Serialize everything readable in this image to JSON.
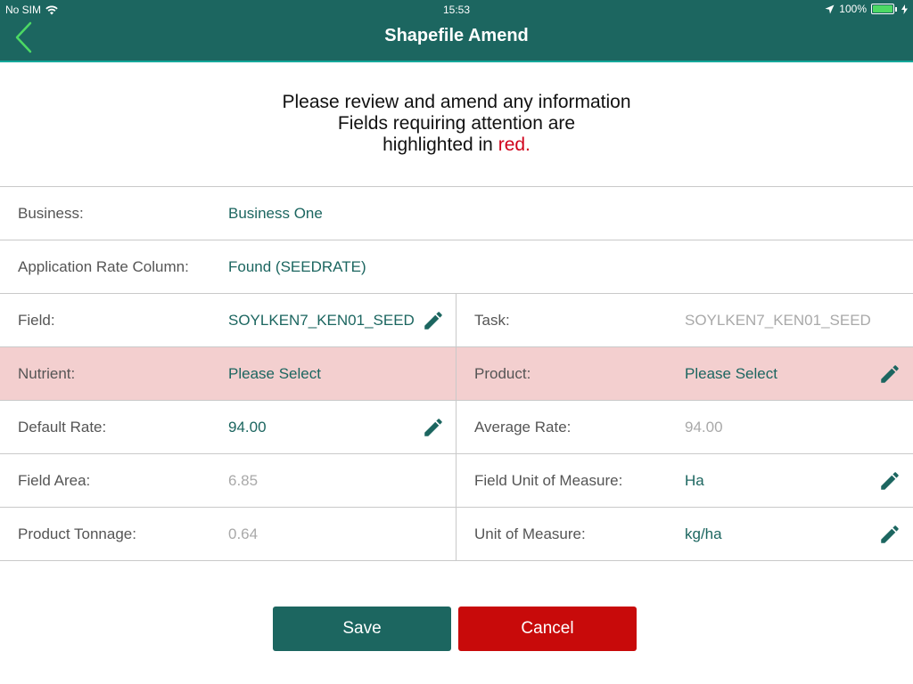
{
  "status_bar": {
    "carrier": "No SIM",
    "time": "15:53",
    "battery": "100%"
  },
  "nav": {
    "title": "Shapefile Amend"
  },
  "intro": {
    "line1": "Please review and amend any information",
    "line2": "Fields requiring attention are",
    "line3_prefix": "highlighted in ",
    "line3_red": "red."
  },
  "form": {
    "business": {
      "label": "Business:",
      "value": "Business One"
    },
    "app_rate_column": {
      "label": "Application Rate Column:",
      "value": "Found (SEEDRATE)"
    },
    "field": {
      "label": "Field:",
      "value": "SOYLKEN7_KEN01_SEED"
    },
    "task": {
      "label": "Task:",
      "value": "SOYLKEN7_KEN01_SEED"
    },
    "nutrient": {
      "label": "Nutrient:",
      "value": "Please Select"
    },
    "product": {
      "label": "Product:",
      "value": "Please Select"
    },
    "default_rate": {
      "label": "Default Rate:",
      "value": "94.00"
    },
    "average_rate": {
      "label": "Average Rate:",
      "value": "94.00"
    },
    "field_area": {
      "label": "Field Area:",
      "value": "6.85"
    },
    "field_uom": {
      "label": "Field Unit of Measure:",
      "value": "Ha"
    },
    "product_tonnage": {
      "label": "Product Tonnage:",
      "value": "0.64"
    },
    "uom": {
      "label": "Unit of Measure:",
      "value": "kg/ha"
    }
  },
  "buttons": {
    "save": "Save",
    "cancel": "Cancel"
  },
  "colors": {
    "brand": "#1c6660",
    "attention": "#f3cfcf",
    "cancel": "#c80a0a",
    "accent_red": "#d0021b"
  },
  "icons": [
    "back-chevron-icon",
    "wifi-icon",
    "location-arrow-icon",
    "battery-icon",
    "pencil-icon"
  ]
}
